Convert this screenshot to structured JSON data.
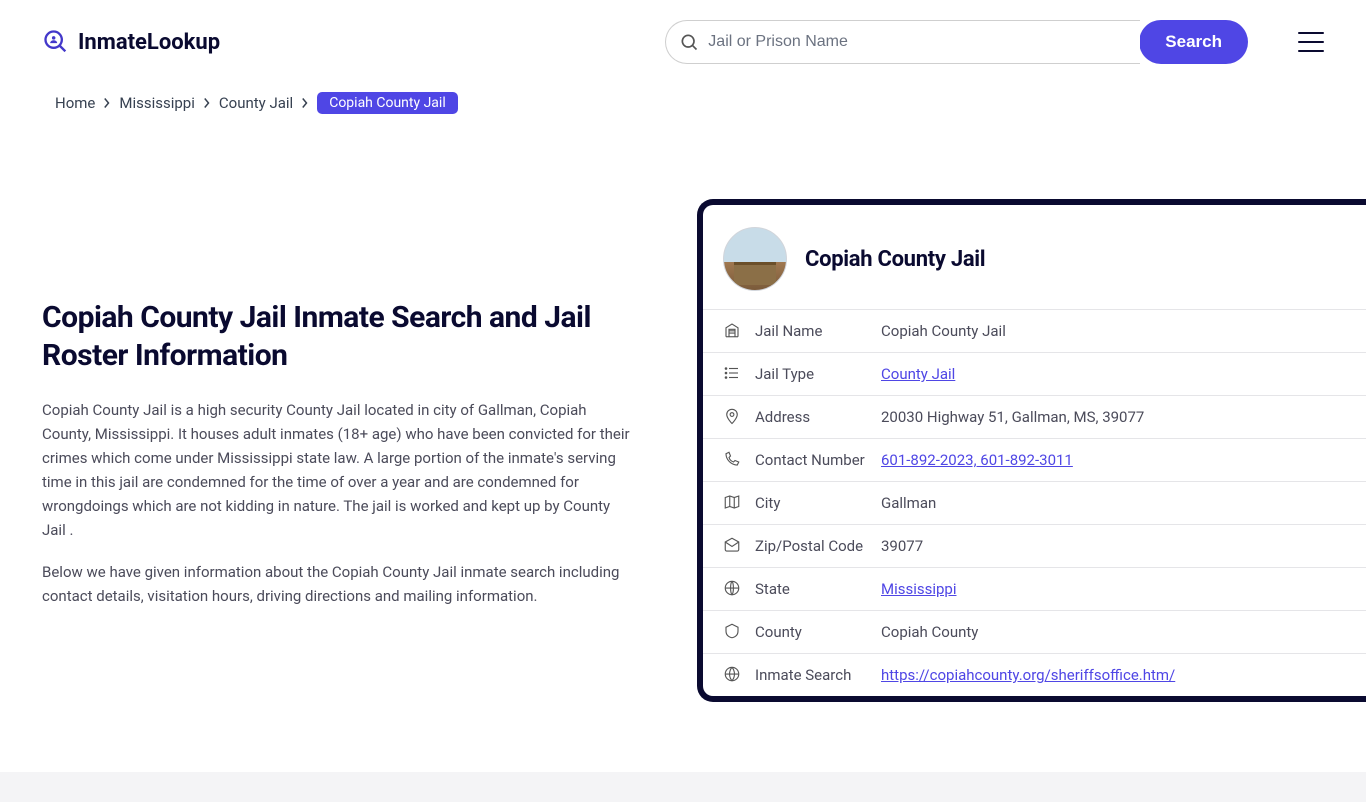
{
  "logo": {
    "text": "InmateLookup"
  },
  "search": {
    "placeholder": "Jail or Prison Name",
    "button": "Search"
  },
  "breadcrumb": {
    "items": [
      "Home",
      "Mississippi",
      "County Jail"
    ],
    "current": "Copiah County Jail"
  },
  "content": {
    "title": "Copiah County Jail Inmate Search and Jail Roster Information",
    "paragraphs": [
      "Copiah County Jail is a high security County Jail located in city of Gallman, Copiah County, Mississippi. It houses adult inmates (18+ age) who have been convicted for their crimes which come under Mississippi state law. A large portion of the inmate's serving time in this jail are condemned for the time of over a year and are condemned for wrongdoings which are not kidding in nature. The jail is worked and kept up by County Jail .",
      "Below we have given information about the Copiah County Jail inmate search including contact details, visitation hours, driving directions and mailing information."
    ]
  },
  "card": {
    "title": "Copiah County Jail",
    "rows": [
      {
        "label": "Jail Name",
        "value": "Copiah County Jail",
        "link": false
      },
      {
        "label": "Jail Type",
        "value": "County Jail",
        "link": true
      },
      {
        "label": "Address",
        "value": "20030 Highway 51, Gallman, MS, 39077",
        "link": false
      },
      {
        "label": "Contact Number",
        "value": "601-892-2023, 601-892-3011",
        "link": true
      },
      {
        "label": "City",
        "value": "Gallman",
        "link": false
      },
      {
        "label": "Zip/Postal Code",
        "value": "39077",
        "link": false
      },
      {
        "label": "State",
        "value": "Mississippi",
        "link": true
      },
      {
        "label": "County",
        "value": "Copiah County",
        "link": false
      },
      {
        "label": "Inmate Search",
        "value": "https://copiahcounty.org/sheriffsoffice.htm/",
        "link": true
      }
    ]
  },
  "icons": [
    "building",
    "list",
    "pin",
    "phone",
    "map",
    "envelope",
    "globe",
    "badge",
    "web"
  ]
}
